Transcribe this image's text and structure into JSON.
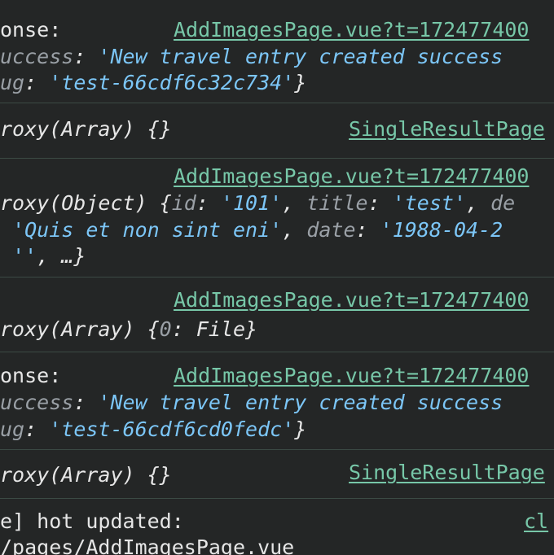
{
  "messages": [
    {
      "source": "AddImagesPage.vue?t=172477400",
      "lines": [
        {
          "parts": [
            {
              "t": "onse:",
              "c": "plain"
            }
          ]
        },
        {
          "parts": [
            {
              "t": "uccess",
              "c": "key"
            },
            {
              "t": ": ",
              "c": "punc"
            },
            {
              "t": "'New travel entry created success",
              "c": "str"
            }
          ]
        },
        {
          "parts": [
            {
              "t": "ug",
              "c": "key"
            },
            {
              "t": ": ",
              "c": "punc"
            },
            {
              "t": "'test-66cdf6c32c734'",
              "c": "str"
            },
            {
              "t": "}",
              "c": "punc"
            }
          ]
        }
      ]
    },
    {
      "source": "SingleResultPage",
      "lines": [
        {
          "parts": [
            {
              "t": "roxy(Array) {}",
              "c": "punc"
            }
          ]
        }
      ]
    },
    {
      "source": "AddImagesPage.vue?t=172477400",
      "lines": [
        {
          "parts": []
        },
        {
          "parts": [
            {
              "t": "roxy(Object) {",
              "c": "punc"
            },
            {
              "t": "id",
              "c": "key"
            },
            {
              "t": ": ",
              "c": "punc"
            },
            {
              "t": "'101'",
              "c": "str"
            },
            {
              "t": ", ",
              "c": "punc"
            },
            {
              "t": "title",
              "c": "key"
            },
            {
              "t": ": ",
              "c": "punc"
            },
            {
              "t": "'test'",
              "c": "str"
            },
            {
              "t": ", ",
              "c": "punc"
            },
            {
              "t": "de",
              "c": "key"
            }
          ]
        },
        {
          "parts": [
            {
              "t": " ",
              "c": "punc"
            },
            {
              "t": "'Quis et non sint eni'",
              "c": "str"
            },
            {
              "t": ", ",
              "c": "punc"
            },
            {
              "t": "date",
              "c": "key"
            },
            {
              "t": ": ",
              "c": "punc"
            },
            {
              "t": "'1988-04-2",
              "c": "str"
            }
          ]
        },
        {
          "parts": [
            {
              "t": " ",
              "c": "punc"
            },
            {
              "t": "''",
              "c": "str"
            },
            {
              "t": ", …}",
              "c": "punc"
            }
          ]
        }
      ]
    },
    {
      "source": "AddImagesPage.vue?t=172477400",
      "lines": [
        {
          "parts": []
        },
        {
          "parts": [
            {
              "t": "roxy(Array) {",
              "c": "punc"
            },
            {
              "t": "0",
              "c": "key"
            },
            {
              "t": ": File}",
              "c": "punc"
            }
          ]
        }
      ]
    },
    {
      "source": "AddImagesPage.vue?t=172477400",
      "lines": [
        {
          "parts": [
            {
              "t": "onse:",
              "c": "plain"
            }
          ]
        },
        {
          "parts": [
            {
              "t": "uccess",
              "c": "key"
            },
            {
              "t": ": ",
              "c": "punc"
            },
            {
              "t": "'New travel entry created success",
              "c": "str"
            }
          ]
        },
        {
          "parts": [
            {
              "t": "ug",
              "c": "key"
            },
            {
              "t": ": ",
              "c": "punc"
            },
            {
              "t": "'test-66cdf6cd0fedc'",
              "c": "str"
            },
            {
              "t": "}",
              "c": "punc"
            }
          ]
        }
      ]
    },
    {
      "source": "SingleResultPage",
      "lines": [
        {
          "parts": [
            {
              "t": "roxy(Array) {}",
              "c": "punc"
            }
          ]
        }
      ]
    },
    {
      "source": "cl",
      "lines": [
        {
          "parts": [
            {
              "t": "e] hot updated:",
              "c": "plain"
            }
          ]
        },
        {
          "parts": [
            {
              "t": "/pages/AddImagesPage.vue",
              "c": "plain"
            }
          ]
        }
      ]
    }
  ]
}
